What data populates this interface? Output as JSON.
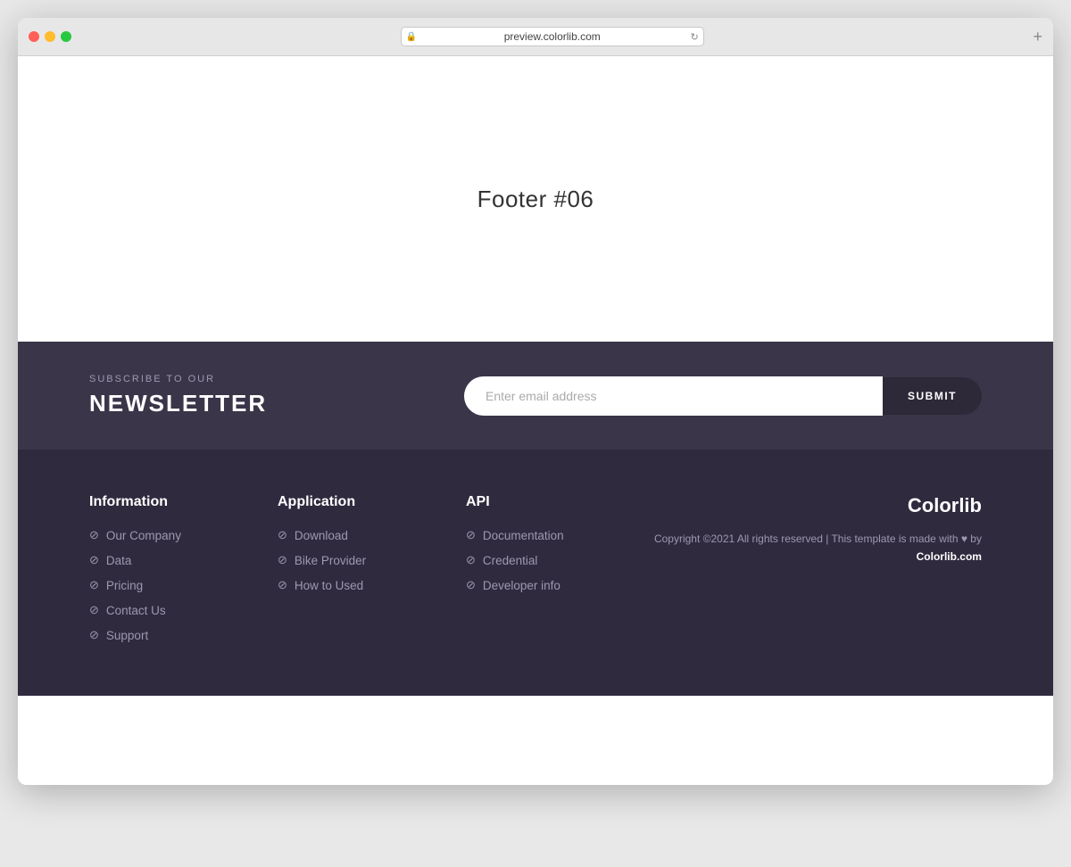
{
  "browser": {
    "url": "preview.colorlib.com",
    "new_tab_label": "+"
  },
  "hero": {
    "title": "Footer #06"
  },
  "newsletter": {
    "subtitle": "SUBSCRIBE TO OUR",
    "title": "NEWSLETTER",
    "input_placeholder": "Enter email address",
    "submit_label": "SUBMIT"
  },
  "footer": {
    "columns": [
      {
        "id": "information",
        "title": "Information",
        "links": [
          "Our Company",
          "Data",
          "Pricing",
          "Contact Us",
          "Support"
        ]
      },
      {
        "id": "application",
        "title": "Application",
        "links": [
          "Download",
          "Bike Provider",
          "How to Used"
        ]
      },
      {
        "id": "api",
        "title": "API",
        "links": [
          "Documentation",
          "Credential",
          "Developer info"
        ]
      }
    ],
    "brand": {
      "name": "Colorlib",
      "copyright_text": "Copyright ©2021 All rights reserved | This template is made with ♥ by",
      "copyright_link_text": "Colorlib.com"
    }
  }
}
